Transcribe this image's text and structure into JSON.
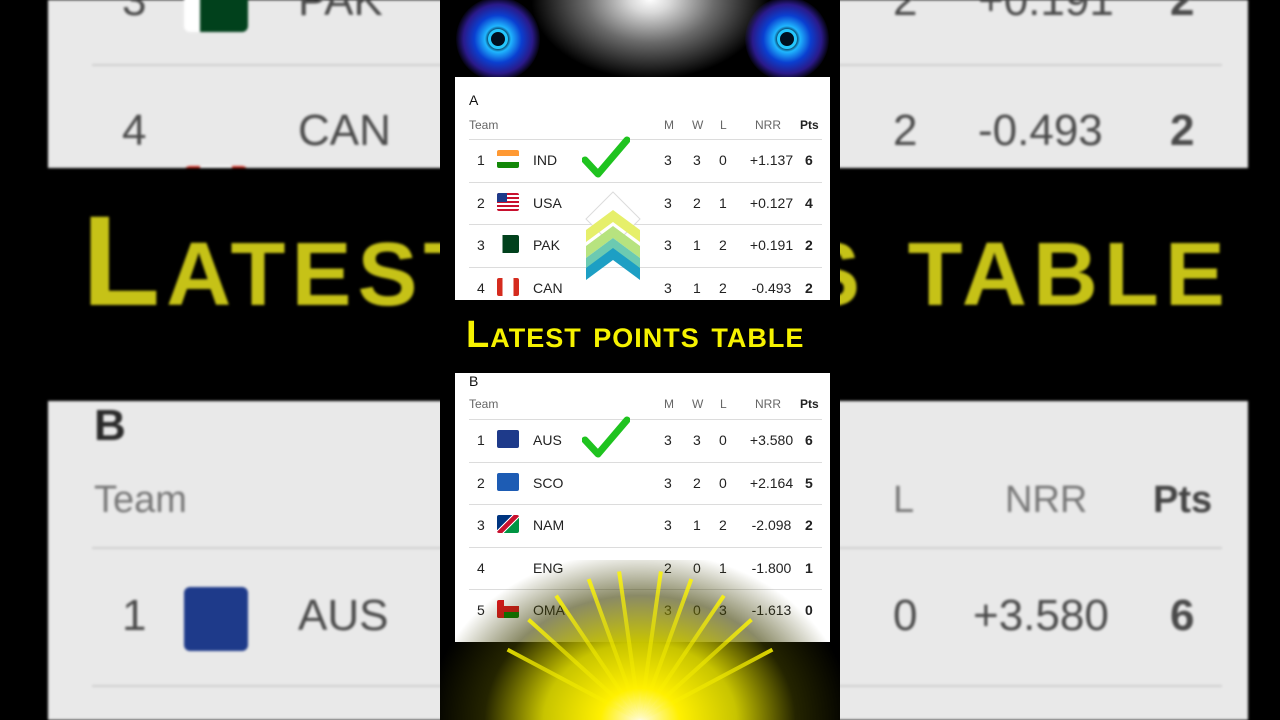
{
  "banner_title": "Latest points table",
  "group_a": {
    "label": "A",
    "headers": {
      "team": "Team",
      "m": "M",
      "w": "W",
      "l": "L",
      "nrr": "NRR",
      "pts": "Pts"
    },
    "rows": [
      {
        "pos": "1",
        "flag": "india-flag",
        "team": "IND",
        "m": "3",
        "w": "3",
        "l": "0",
        "nrr": "+1.137",
        "pts": "6"
      },
      {
        "pos": "2",
        "flag": "usa-flag",
        "team": "USA",
        "m": "3",
        "w": "2",
        "l": "1",
        "nrr": "+0.127",
        "pts": "4"
      },
      {
        "pos": "3",
        "flag": "pakistan-flag",
        "team": "PAK",
        "m": "3",
        "w": "1",
        "l": "2",
        "nrr": "+0.191",
        "pts": "2"
      },
      {
        "pos": "4",
        "flag": "canada-flag",
        "team": "CAN",
        "m": "3",
        "w": "1",
        "l": "2",
        "nrr": "-0.493",
        "pts": "2"
      }
    ]
  },
  "group_b": {
    "label": "B",
    "headers": {
      "team": "Team",
      "m": "M",
      "w": "W",
      "l": "L",
      "nrr": "NRR",
      "pts": "Pts"
    },
    "rows": [
      {
        "pos": "1",
        "flag": "australia-flag",
        "team": "AUS",
        "m": "3",
        "w": "3",
        "l": "0",
        "nrr": "+3.580",
        "pts": "6"
      },
      {
        "pos": "2",
        "flag": "scotland-flag",
        "team": "SCO",
        "m": "3",
        "w": "2",
        "l": "0",
        "nrr": "+2.164",
        "pts": "5"
      },
      {
        "pos": "3",
        "flag": "namibia-flag",
        "team": "NAM",
        "m": "3",
        "w": "1",
        "l": "2",
        "nrr": "-2.098",
        "pts": "2"
      },
      {
        "pos": "4",
        "flag": "england-flag",
        "team": "ENG",
        "m": "2",
        "w": "0",
        "l": "1",
        "nrr": "-1.800",
        "pts": "1"
      },
      {
        "pos": "5",
        "flag": "oman-flag",
        "team": "OMA",
        "m": "3",
        "w": "0",
        "l": "3",
        "nrr": "-1.613",
        "pts": "0"
      }
    ]
  },
  "background": {
    "top_row_3": {
      "pos": "3",
      "team": "PAK",
      "l": "2",
      "nrr": "+0.191",
      "pts": "2"
    },
    "top_row_4": {
      "pos": "4",
      "team": "CAN",
      "l": "2",
      "nrr": "-0.493",
      "pts": "2"
    },
    "big_text_left": "Latest",
    "big_text_right": "s table",
    "group_label": "B",
    "header_team": "Team",
    "header_l": "L",
    "header_nrr": "NRR",
    "header_pts": "Pts",
    "row_1": {
      "pos": "1",
      "team": "AUS",
      "l": "0",
      "nrr": "+3.580",
      "pts": "6"
    }
  },
  "colors": {
    "banner_text": "#f6f200",
    "check": "#1fc31f",
    "page_bg": "#000000"
  }
}
